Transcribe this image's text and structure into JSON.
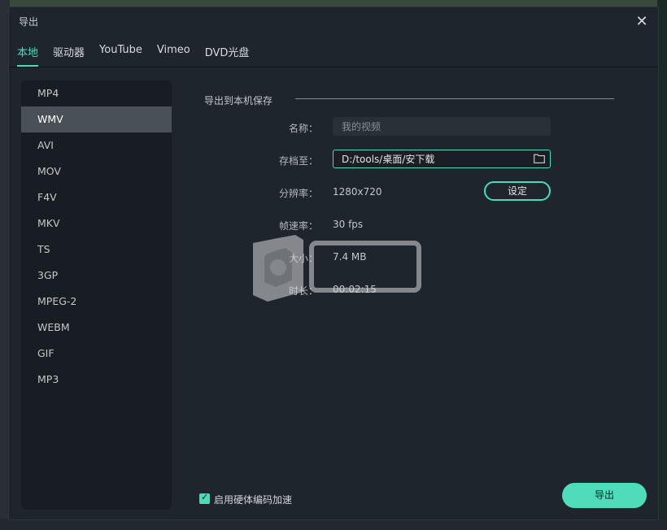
{
  "dialog": {
    "title": "导出",
    "close_glyph": "✕"
  },
  "tabs": [
    {
      "label": "本地",
      "active": true
    },
    {
      "label": "驱动器",
      "active": false
    },
    {
      "label": "YouTube",
      "active": false
    },
    {
      "label": "Vimeo",
      "active": false
    },
    {
      "label": "DVD光盘",
      "active": false
    }
  ],
  "formats": [
    {
      "label": "MP4",
      "selected": false
    },
    {
      "label": "WMV",
      "selected": true
    },
    {
      "label": "AVI",
      "selected": false
    },
    {
      "label": "MOV",
      "selected": false
    },
    {
      "label": "F4V",
      "selected": false
    },
    {
      "label": "MKV",
      "selected": false
    },
    {
      "label": "TS",
      "selected": false
    },
    {
      "label": "3GP",
      "selected": false
    },
    {
      "label": "MPEG-2",
      "selected": false
    },
    {
      "label": "WEBM",
      "selected": false
    },
    {
      "label": "GIF",
      "selected": false
    },
    {
      "label": "MP3",
      "selected": false
    }
  ],
  "settings": {
    "section_title": "导出到本机保存",
    "name_label": "名称：",
    "name_placeholder": "我的视频",
    "save_to_label": "存档至：",
    "save_path": "D:/tools/桌面/安下载",
    "folder_icon": "folder-icon",
    "resolution_label": "分辨率：",
    "resolution_value": "1280x720",
    "set_button": "设定",
    "framerate_label": "帧速率：",
    "framerate_value": "30 fps",
    "size_label": "大小：",
    "size_value": "7.4 MB",
    "duration_label": "时长：",
    "duration_value": "00:02:15"
  },
  "footer": {
    "hardware_encoding_label": "启用硬体编码加速",
    "hardware_encoding_checked": true,
    "export_button": "导出"
  },
  "colors": {
    "accent": "#48dcb9",
    "dialog_bg": "#1f252c",
    "panel_bg": "#181d23",
    "selected_bg": "#4a5058"
  }
}
